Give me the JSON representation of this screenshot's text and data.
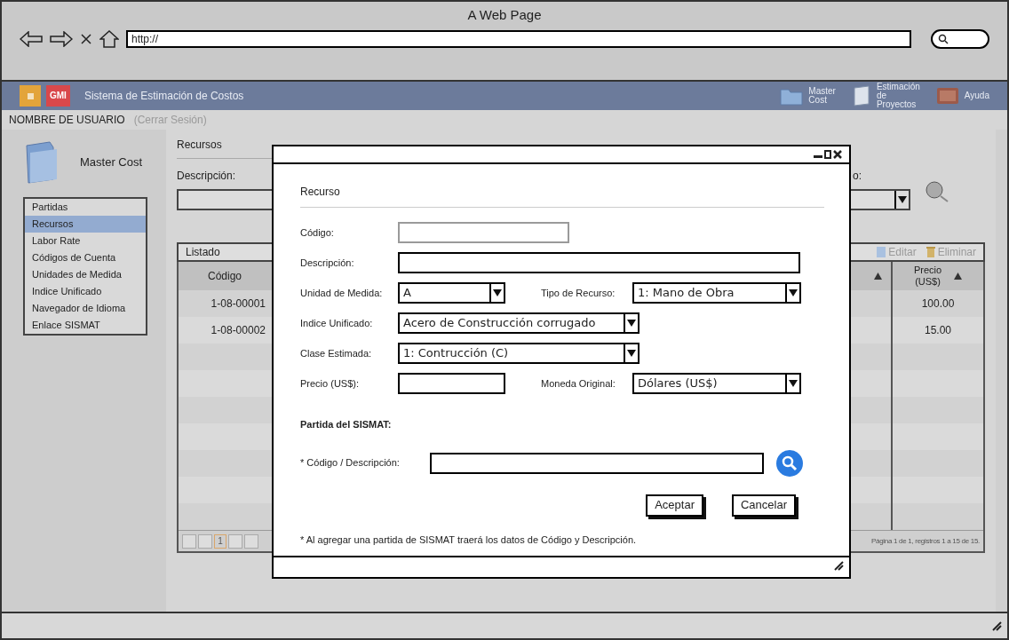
{
  "browser": {
    "title": "A Web Page",
    "url": "http://"
  },
  "app_header": {
    "logo_text": "GMI",
    "title": "Sistema de Estimación de Costos",
    "nav": [
      {
        "kind": "folder",
        "label": "Master Cost"
      },
      {
        "kind": "document",
        "label": "Estimación de Proyectos"
      },
      {
        "kind": "book",
        "label": "Ayuda"
      }
    ]
  },
  "user_bar": {
    "username": "NOMBRE DE USUARIO",
    "logout": "(Cerrar Sesión)"
  },
  "sidebar": {
    "title": "Master Cost",
    "items": [
      {
        "label": "Partidas",
        "selected": false
      },
      {
        "label": "Recursos",
        "selected": true
      },
      {
        "label": "Labor Rate",
        "selected": false
      },
      {
        "label": "Códigos de Cuenta",
        "selected": false
      },
      {
        "label": "Unidades de Medida",
        "selected": false
      },
      {
        "label": "Indice Unificado",
        "selected": false
      },
      {
        "label": "Navegador de Idioma",
        "selected": false
      },
      {
        "label": "Enlace SISMAT",
        "selected": false
      }
    ]
  },
  "main": {
    "section_title": "Recursos",
    "filter_label": "Descripción:",
    "filter_label_2": "o:",
    "listado": {
      "title": "Listado",
      "toolbar": [
        {
          "kind": "edit",
          "label": "Editar"
        },
        {
          "kind": "delete",
          "label": "Eliminar"
        }
      ],
      "columns": [
        "Código",
        "Precio\n(US$)"
      ],
      "rows": [
        {
          "code": "1-08-00001",
          "price": "100.00"
        },
        {
          "code": "1-08-00002",
          "price": "15.00"
        }
      ],
      "pager": {
        "page": "1",
        "summary": "Página 1 de 1, registros 1 a 15 de 15."
      }
    }
  },
  "dialog": {
    "section_title": "Recurso",
    "rows": [
      [
        {
          "label": "Código:",
          "kind": "text",
          "disabled": true
        }
      ],
      [
        {
          "label": "Descripción:",
          "kind": "text",
          "disabled": false
        }
      ],
      [
        {
          "label": "Unidad de Medida:",
          "kind": "select",
          "value": "A"
        },
        {
          "label": "Tipo de Recurso:",
          "kind": "select",
          "value": "1: Mano de Obra"
        }
      ],
      [
        {
          "label": "Indice Unificado:",
          "kind": "select",
          "value": "Acero de Construcción corrugado"
        }
      ],
      [
        {
          "label": "Clase Estimada:",
          "kind": "select",
          "value": "1: Contrucción (C)"
        }
      ],
      [
        {
          "label": "Precio (US$):",
          "kind": "text",
          "disabled": false
        },
        {
          "label": "Moneda Original:",
          "kind": "select",
          "value": "Dólares (US$)"
        }
      ]
    ],
    "sismat_title": "Partida del SISMAT:",
    "sismat_label": "* Código / Descripción:",
    "buttons": [
      "Aceptar",
      "Cancelar"
    ],
    "note": "* Al agregar una partida de SISMAT traerá los datos de Código y Descripción."
  }
}
